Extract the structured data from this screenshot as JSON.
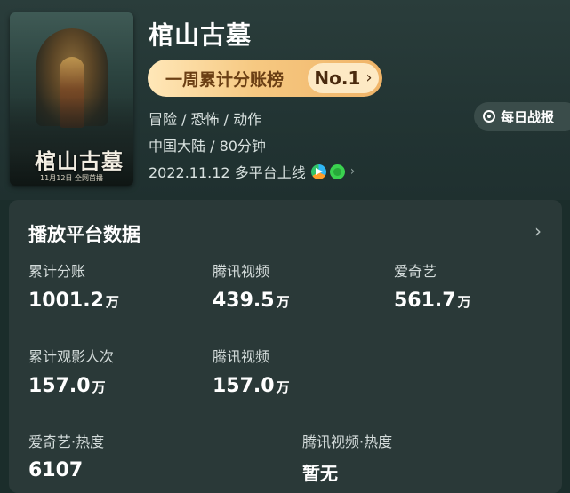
{
  "movie": {
    "title": "棺山古墓",
    "poster_title": "棺山古墓",
    "poster_date": "11月12日 全网首播",
    "rank_label": "一周累计分账榜",
    "rank_value": "No.1",
    "genres": "冒险 / 恐怖 / 动作",
    "region_runtime": "中国大陆 / 80分钟",
    "release": "2022.11.12  多平台上线",
    "platform_icons": [
      "tencent-video-icon",
      "iqiyi-icon"
    ]
  },
  "daily_report": {
    "label": "每日战报"
  },
  "card": {
    "title": "播放平台数据",
    "stats": [
      {
        "label": "累计分账",
        "value": "1001.2",
        "unit": "万"
      },
      {
        "label": "腾讯视频",
        "value": "439.5",
        "unit": "万"
      },
      {
        "label": "爱奇艺",
        "value": "561.7",
        "unit": "万"
      },
      {
        "label": "累计观影人次",
        "value": "157.0",
        "unit": "万"
      },
      {
        "label": "腾讯视频",
        "value": "157.0",
        "unit": "万"
      },
      {
        "label": "爱奇艺·热度",
        "value": "6107",
        "unit": ""
      },
      {
        "label": "腾讯视频·热度",
        "value": "暂无",
        "unit": ""
      }
    ]
  },
  "colors": {
    "background": "#1b2d2b",
    "card": "#2a3938",
    "rank_gold": "#f6c982",
    "rank_text": "#6b3f14"
  }
}
